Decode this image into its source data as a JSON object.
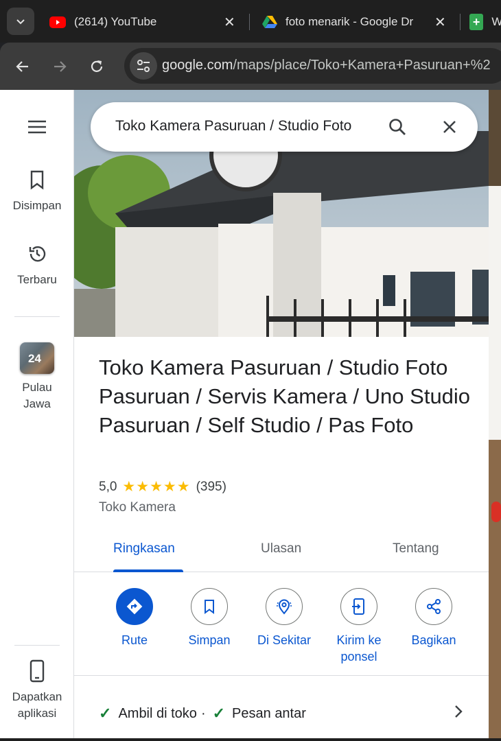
{
  "browser": {
    "tabs": [
      {
        "title": "(2614) YouTube",
        "icon": "youtube-icon"
      },
      {
        "title": "foto menarik - Google Dr",
        "icon": "google-drive-icon"
      },
      {
        "title": "W",
        "icon": "google-sheets-icon"
      }
    ],
    "url_host": "google.com",
    "url_path": "/maps/place/Toko+Kamera+Pasuruan+%2"
  },
  "rail": {
    "saved_label": "Disimpan",
    "recent_label": "Terbaru",
    "layer_badge": "24",
    "layer_label_1": "Pulau",
    "layer_label_2": "Jawa",
    "app_label_1": "Dapatkan",
    "app_label_2": "aplikasi"
  },
  "search": {
    "value": "Toko Kamera Pasuruan / Studio Foto"
  },
  "place": {
    "name": "Toko Kamera Pasuruan / Studio Foto Pasuruan / Servis Kamera / Uno Studio Pasuruan / Self Studio / Pas Foto",
    "rating": "5,0",
    "stars": "★★★★★",
    "review_count": "(395)",
    "category": "Toko Kamera"
  },
  "tabs": {
    "overview": "Ringkasan",
    "reviews": "Ulasan",
    "about": "Tentang"
  },
  "actions": {
    "route": "Rute",
    "save": "Simpan",
    "nearby": "Di Sekitar",
    "send_1": "Kirim ke",
    "send_2": "ponsel",
    "share": "Bagikan"
  },
  "services": {
    "pickup": "Ambil di toko",
    "separator": "·",
    "delivery": "Pesan antar"
  },
  "colors": {
    "accent": "#0b57d0",
    "star": "#fbbc04",
    "check": "#188038"
  }
}
